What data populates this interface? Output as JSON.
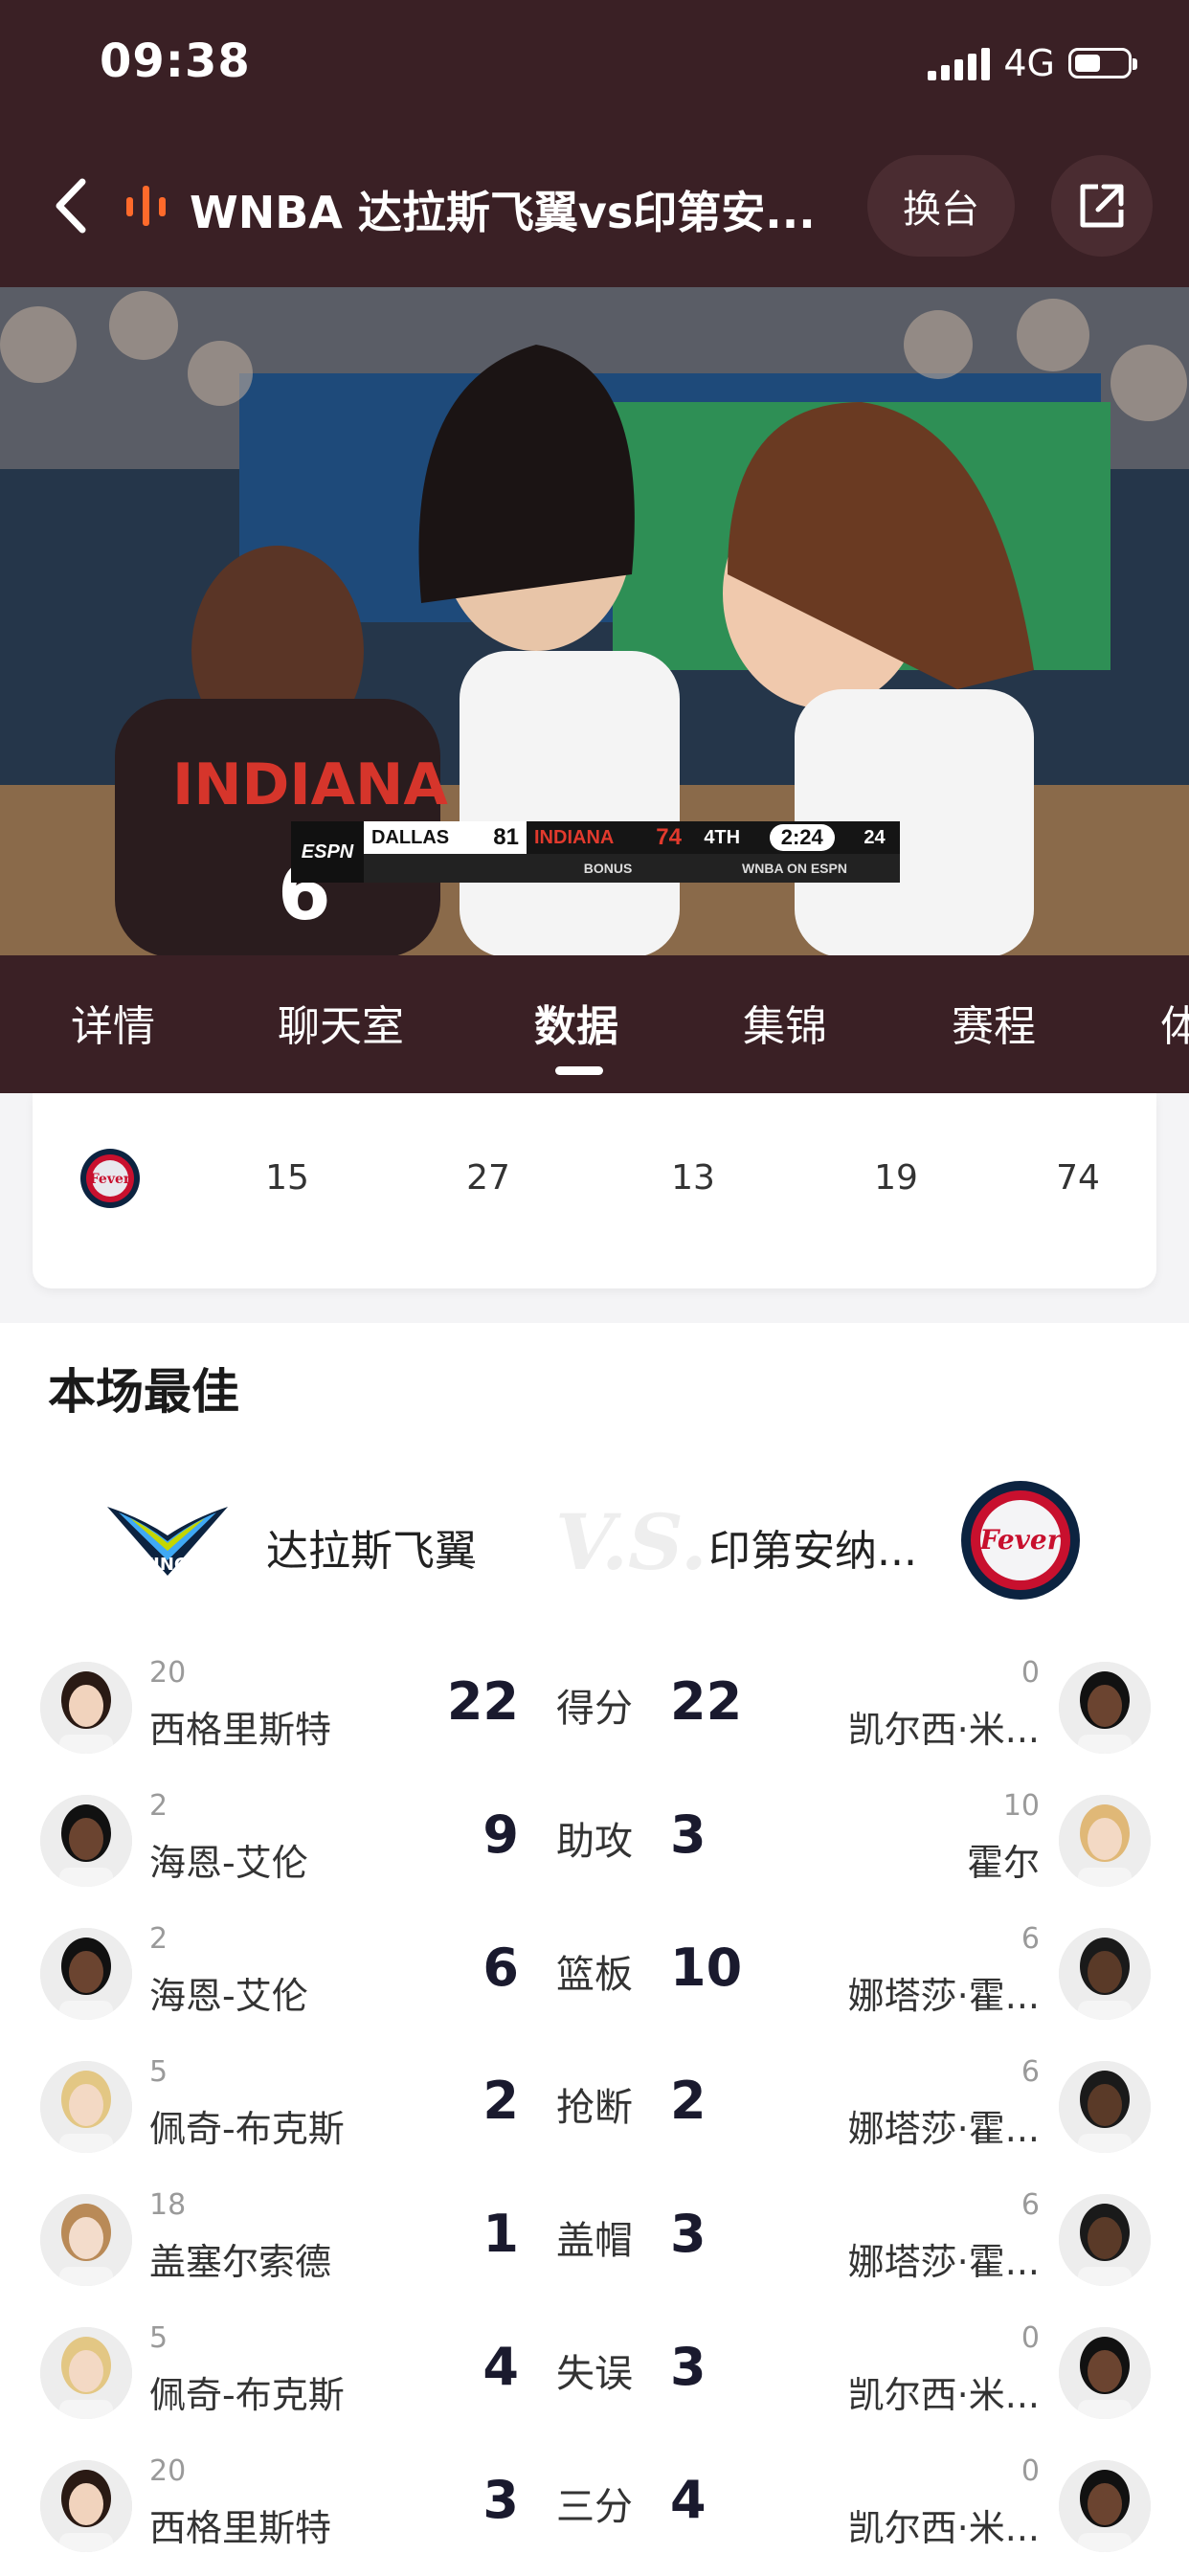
{
  "status": {
    "time": "09:38",
    "network": "4G"
  },
  "header": {
    "title": "WNBA 达拉斯飞翼vs印第安...",
    "switch_label": "换台"
  },
  "scorebug": {
    "network": "ESPN",
    "team1": "DALLAS",
    "score1": "81",
    "team2": "INDIANA",
    "score2": "74",
    "quarter": "4TH",
    "clock": "2:24",
    "shot_clock": "24",
    "bonus": "BONUS",
    "broadcast": "WNBA ON ESPN"
  },
  "tabs": [
    "详情",
    "聊天室",
    "数据",
    "集锦",
    "赛程",
    "体"
  ],
  "active_tab": "数据",
  "quarter_scores": {
    "team": "Fever",
    "values": [
      "15",
      "27",
      "13",
      "19",
      "74"
    ]
  },
  "best": {
    "title": "本场最佳",
    "left_team": {
      "name": "达拉斯飞翼",
      "logo": "WINGS"
    },
    "right_team": {
      "name": "印第安纳...",
      "logo": "Fever"
    },
    "vs": "V.S.",
    "rows": [
      {
        "stat": "得分",
        "left": {
          "num": "20",
          "name": "西格里斯特",
          "value": "22"
        },
        "right": {
          "num": "0",
          "name": "凯尔西·米...",
          "value": "22"
        }
      },
      {
        "stat": "助攻",
        "left": {
          "num": "2",
          "name": "海恩-艾伦",
          "value": "9"
        },
        "right": {
          "num": "10",
          "name": "霍尔",
          "value": "3"
        }
      },
      {
        "stat": "篮板",
        "left": {
          "num": "2",
          "name": "海恩-艾伦",
          "value": "6"
        },
        "right": {
          "num": "6",
          "name": "娜塔莎·霍...",
          "value": "10"
        }
      },
      {
        "stat": "抢断",
        "left": {
          "num": "5",
          "name": "佩奇-布克斯",
          "value": "2"
        },
        "right": {
          "num": "6",
          "name": "娜塔莎·霍...",
          "value": "2"
        }
      },
      {
        "stat": "盖帽",
        "left": {
          "num": "18",
          "name": "盖塞尔索德",
          "value": "1"
        },
        "right": {
          "num": "6",
          "name": "娜塔莎·霍...",
          "value": "3"
        }
      },
      {
        "stat": "失误",
        "left": {
          "num": "5",
          "name": "佩奇-布克斯",
          "value": "4"
        },
        "right": {
          "num": "0",
          "name": "凯尔西·米...",
          "value": "3"
        }
      },
      {
        "stat": "三分",
        "left": {
          "num": "20",
          "name": "西格里斯特",
          "value": "3"
        },
        "right": {
          "num": "0",
          "name": "凯尔西·米...",
          "value": "4"
        }
      }
    ]
  }
}
